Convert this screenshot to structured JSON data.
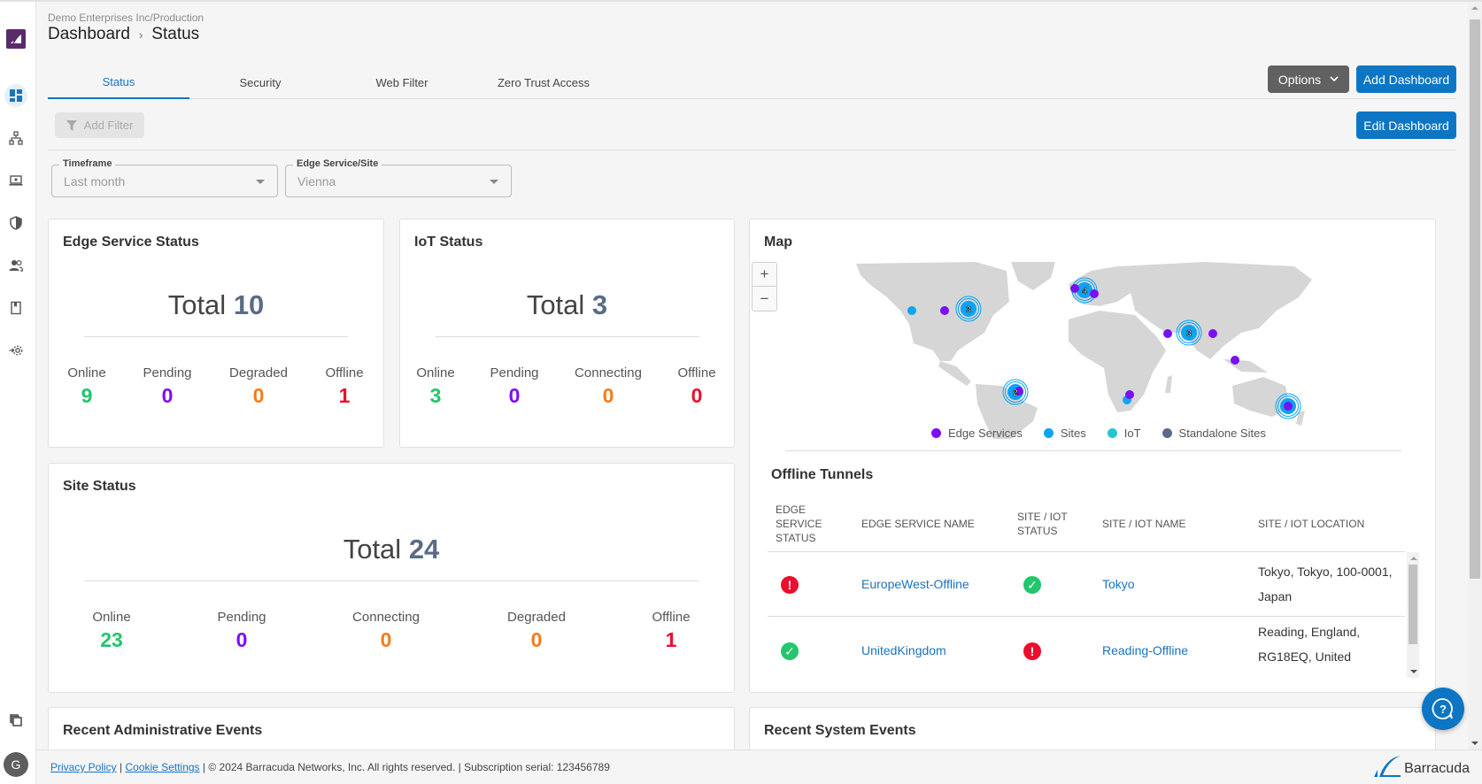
{
  "header": {
    "org_path": "Demo Enterprises Inc/Production",
    "breadcrumb": [
      "Dashboard",
      "Status"
    ],
    "separator": "›"
  },
  "tabs": [
    {
      "label": "Status",
      "active": true
    },
    {
      "label": "Security",
      "active": false
    },
    {
      "label": "Web Filter",
      "active": false
    },
    {
      "label": "Zero Trust Access",
      "active": false
    }
  ],
  "toolbar": {
    "options_label": "Options",
    "add_dashboard_label": "Add Dashboard",
    "edit_dashboard_label": "Edit Dashboard",
    "add_filter_label": "Add Filter"
  },
  "filters": {
    "timeframe": {
      "label": "Timeframe",
      "value": "Last month"
    },
    "edge_site": {
      "label": "Edge Service/Site",
      "value": "Vienna"
    }
  },
  "sidebar": {
    "items": [
      {
        "icon": "dashboard-icon",
        "active": true
      },
      {
        "icon": "network-topology-icon",
        "active": false
      },
      {
        "icon": "laptop-device-icon",
        "active": false
      },
      {
        "icon": "shield-icon",
        "active": false
      },
      {
        "icon": "users-icon",
        "active": false
      },
      {
        "icon": "book-icon",
        "active": false
      },
      {
        "icon": "integration-gear-icon",
        "active": false
      }
    ],
    "bottom_icon": "copy-stack-icon",
    "avatar_initial": "G"
  },
  "cards": {
    "edge_service": {
      "title": "Edge Service Status",
      "total_label": "Total",
      "total": "10",
      "stats": [
        {
          "label": "Online",
          "value": "9",
          "color": "#24c56c"
        },
        {
          "label": "Pending",
          "value": "0",
          "color": "#7a10f5"
        },
        {
          "label": "Degraded",
          "value": "0",
          "color": "#f57c1a"
        },
        {
          "label": "Offline",
          "value": "1",
          "color": "#ea0f2c"
        }
      ]
    },
    "iot": {
      "title": "IoT Status",
      "total_label": "Total",
      "total": "3",
      "stats": [
        {
          "label": "Online",
          "value": "3",
          "color": "#24c56c"
        },
        {
          "label": "Pending",
          "value": "0",
          "color": "#7a10f5"
        },
        {
          "label": "Connecting",
          "value": "0",
          "color": "#f57c1a"
        },
        {
          "label": "Offline",
          "value": "0",
          "color": "#ea0f2c"
        }
      ]
    },
    "site": {
      "title": "Site Status",
      "total_label": "Total",
      "total": "24",
      "stats": [
        {
          "label": "Online",
          "value": "23",
          "color": "#24c56c"
        },
        {
          "label": "Pending",
          "value": "0",
          "color": "#7a10f5"
        },
        {
          "label": "Connecting",
          "value": "0",
          "color": "#f57c1a"
        },
        {
          "label": "Degraded",
          "value": "0",
          "color": "#f57c1a"
        },
        {
          "label": "Offline",
          "value": "1",
          "color": "#ea0f2c"
        }
      ]
    },
    "recent_admin": {
      "title": "Recent Administrative Events"
    },
    "recent_system": {
      "title": "Recent System Events"
    }
  },
  "map": {
    "title": "Map",
    "zoom_in": "+",
    "zoom_out": "−",
    "clusters": [
      {
        "count": "3",
        "region": "US East"
      },
      {
        "count": "4",
        "region": "Western Europe"
      },
      {
        "count": "3",
        "region": "India"
      },
      {
        "count": "2",
        "region": "Brazil"
      }
    ],
    "legend": [
      {
        "label": "Edge Services",
        "color": "#7a10f5"
      },
      {
        "label": "Sites",
        "color": "#0ba4f5"
      },
      {
        "label": "IoT",
        "color": "#26c6cf"
      },
      {
        "label": "Standalone Sites",
        "color": "#5b6b86"
      }
    ]
  },
  "offline_tunnels": {
    "title": "Offline Tunnels",
    "columns": [
      "EDGE SERVICE STATUS",
      "EDGE SERVICE NAME",
      "SITE / IOT STATUS",
      "SITE / IOT NAME",
      "SITE / IOT LOCATION"
    ],
    "rows": [
      {
        "edge_status": "error",
        "edge_name": "EuropeWest-Offline",
        "site_status": "ok",
        "site_name": "Tokyo",
        "location_line1": "Tokyo, Tokyo, 100-0001,",
        "location_line2": "Japan"
      },
      {
        "edge_status": "ok",
        "edge_name": "UnitedKingdom",
        "site_status": "error",
        "site_name": "Reading-Offline",
        "location_line1": "Reading, England,",
        "location_line2": "RG18EQ, United"
      }
    ]
  },
  "footer": {
    "privacy": "Privacy Policy",
    "cookie": "Cookie Settings",
    "sep": "|",
    "copyright": "| © 2024 Barracuda Networks, Inc. All rights reserved. | Subscription serial: 123456789",
    "brand": "Barracuda"
  }
}
